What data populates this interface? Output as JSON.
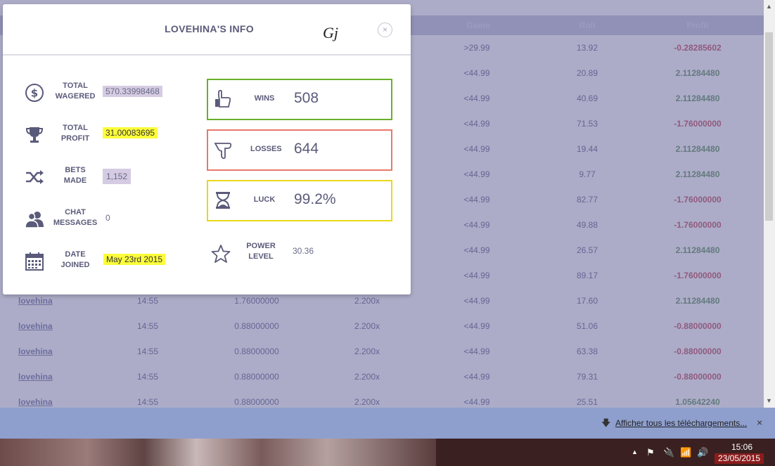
{
  "table": {
    "headers": [
      "Game",
      "Roll",
      "Profit"
    ],
    "rows": [
      {
        "user": "",
        "time": "",
        "bet": "",
        "payout": "",
        "game": ">29.99",
        "roll": "13.92",
        "profit": "-0.28285602",
        "neg": true
      },
      {
        "user": "",
        "time": "",
        "bet": "",
        "payout": "",
        "game": "<44.99",
        "roll": "20.89",
        "profit": "2.11284480",
        "neg": false
      },
      {
        "user": "",
        "time": "",
        "bet": "",
        "payout": "",
        "game": "<44.99",
        "roll": "40.69",
        "profit": "2.11284480",
        "neg": false
      },
      {
        "user": "",
        "time": "",
        "bet": "",
        "payout": "",
        "game": "<44.99",
        "roll": "71.53",
        "profit": "-1.76000000",
        "neg": true
      },
      {
        "user": "",
        "time": "",
        "bet": "",
        "payout": "",
        "game": "<44.99",
        "roll": "19.44",
        "profit": "2.11284480",
        "neg": false
      },
      {
        "user": "",
        "time": "",
        "bet": "",
        "payout": "",
        "game": "<44.99",
        "roll": "9.77",
        "profit": "2.11284480",
        "neg": false
      },
      {
        "user": "",
        "time": "",
        "bet": "",
        "payout": "",
        "game": "<44.99",
        "roll": "82.77",
        "profit": "-1.76000000",
        "neg": true
      },
      {
        "user": "",
        "time": "",
        "bet": "",
        "payout": "",
        "game": "<44.99",
        "roll": "49.88",
        "profit": "-1.76000000",
        "neg": true
      },
      {
        "user": "",
        "time": "",
        "bet": "",
        "payout": "",
        "game": "<44.99",
        "roll": "26.57",
        "profit": "2.11284480",
        "neg": false
      },
      {
        "user": "",
        "time": "",
        "bet": "",
        "payout": "",
        "game": "<44.99",
        "roll": "89.17",
        "profit": "-1.76000000",
        "neg": true
      },
      {
        "user": "lovehina",
        "time": "14:55",
        "bet": "1.76000000",
        "payout": "2.200x",
        "game": "<44.99",
        "roll": "17.60",
        "profit": "2.11284480",
        "neg": false
      },
      {
        "user": "lovehina",
        "time": "14:55",
        "bet": "0.88000000",
        "payout": "2.200x",
        "game": "<44.99",
        "roll": "51.06",
        "profit": "-0.88000000",
        "neg": true
      },
      {
        "user": "lovehina",
        "time": "14:55",
        "bet": "0.88000000",
        "payout": "2.200x",
        "game": "<44.99",
        "roll": "63.38",
        "profit": "-0.88000000",
        "neg": true
      },
      {
        "user": "lovehina",
        "time": "14:55",
        "bet": "0.88000000",
        "payout": "2.200x",
        "game": "<44.99",
        "roll": "79.31",
        "profit": "-0.88000000",
        "neg": true
      },
      {
        "user": "lovehina",
        "time": "14:55",
        "bet": "0.88000000",
        "payout": "2.200x",
        "game": "<44.99",
        "roll": "25.51",
        "profit": "1.05642240",
        "neg": false
      }
    ]
  },
  "modal": {
    "title": "LOVEHINA'S INFO",
    "signature": "Gj",
    "close_glyph": "×",
    "stats": {
      "total_wagered": {
        "label_1": "TOTAL",
        "label_2": "WAGERED",
        "value": "570.33998468"
      },
      "total_profit": {
        "label_1": "TOTAL",
        "label_2": "PROFIT",
        "value": "31.00083695"
      },
      "bets_made": {
        "label_1": "BETS",
        "label_2": "MADE",
        "value": "1,152"
      },
      "chat_messages": {
        "label_1": "CHAT",
        "label_2": "MESSAGES",
        "value": "0"
      },
      "date_joined": {
        "label_1": "DATE",
        "label_2": "JOINED",
        "value": "May 23rd 2015"
      }
    },
    "wins": {
      "label": "WINS",
      "value": "508"
    },
    "losses": {
      "label": "LOSSES",
      "value": "644"
    },
    "luck": {
      "label": "LUCK",
      "value": "99.2%"
    },
    "power_level": {
      "label_1": "POWER",
      "label_2": "LEVEL",
      "value": "30.36"
    }
  },
  "download_bar": {
    "link_text": "Afficher tous les téléchargements...",
    "close_glyph": "×"
  },
  "taskbar": {
    "time": "15:06",
    "date": "23/05/2015"
  },
  "colors": {
    "wins_border": "#6ab02a",
    "losses_border": "#e8786a",
    "luck_border": "#e8d81a",
    "negative_profit": "#c86a7a",
    "positive_profit": "#7aa07a"
  }
}
